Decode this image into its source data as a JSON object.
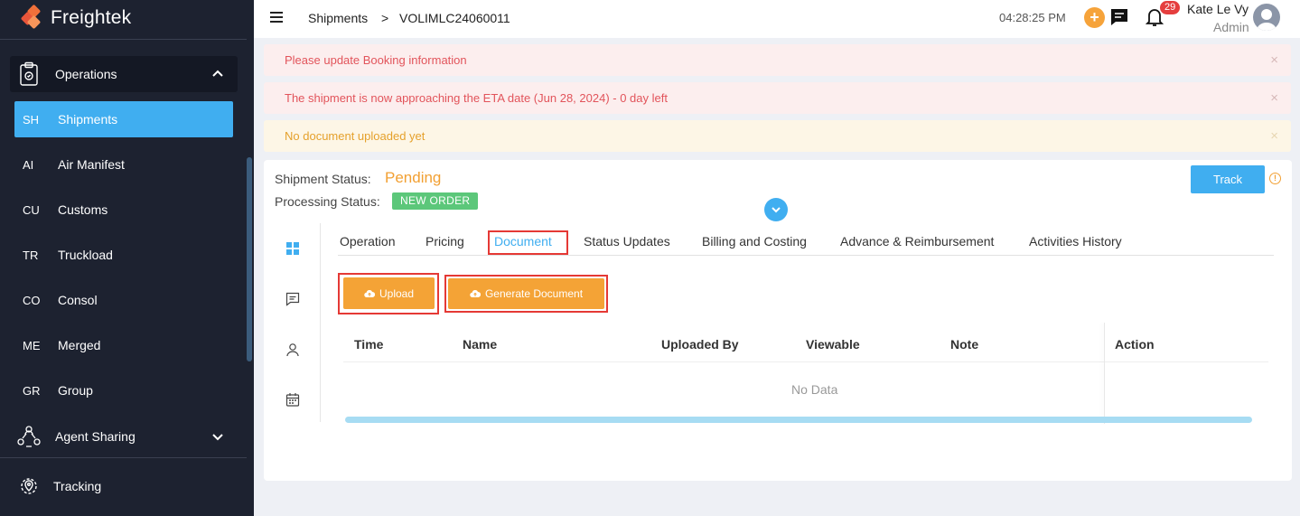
{
  "app": {
    "name": "Freightek"
  },
  "sidebar": {
    "group_label": "Operations",
    "items": [
      {
        "abbr": "SH",
        "label": "Shipments",
        "active": true
      },
      {
        "abbr": "AI",
        "label": "Air Manifest"
      },
      {
        "abbr": "CU",
        "label": "Customs"
      },
      {
        "abbr": "TR",
        "label": "Truckload"
      },
      {
        "abbr": "CO",
        "label": "Consol"
      },
      {
        "abbr": "ME",
        "label": "Merged"
      },
      {
        "abbr": "GR",
        "label": "Group"
      }
    ],
    "agent_sharing": "Agent Sharing",
    "tracking": "Tracking"
  },
  "header": {
    "breadcrumb_root": "Shipments",
    "breadcrumb_sep": ">",
    "breadcrumb_current": "VOLIMLC24060011",
    "time": "04:28:25 PM",
    "plus": "+",
    "notifications": "29",
    "user_name": "Kate Le Vy",
    "user_role": "Admin"
  },
  "alerts": [
    {
      "text": "Please update Booking information",
      "type": "error"
    },
    {
      "text": "The shipment is now approaching the ETA date (Jun 28, 2024) - 0 day left",
      "type": "error"
    },
    {
      "text": "No document uploaded yet",
      "type": "warning"
    }
  ],
  "alert_close": "×",
  "status": {
    "shipment_label": "Shipment Status:",
    "shipment_value": "Pending",
    "processing_label": "Processing Status:",
    "processing_value": "NEW ORDER",
    "track_button": "Track",
    "info_glyph": "!"
  },
  "tabs": [
    "Operation",
    "Pricing",
    "Document",
    "Status Updates",
    "Billing and Costing",
    "Advance & Reimbursement",
    "Activities History"
  ],
  "active_tab": "Document",
  "buttons": {
    "upload": "Upload",
    "generate": "Generate Document"
  },
  "table": {
    "columns": [
      "Time",
      "Name",
      "Uploaded By",
      "Viewable",
      "Note",
      "Action"
    ],
    "empty": "No Data"
  },
  "colors": {
    "accent": "#40aef0",
    "orange": "#f4a336",
    "sidebar": "#1d2230",
    "highlight_box": "#e53935"
  }
}
